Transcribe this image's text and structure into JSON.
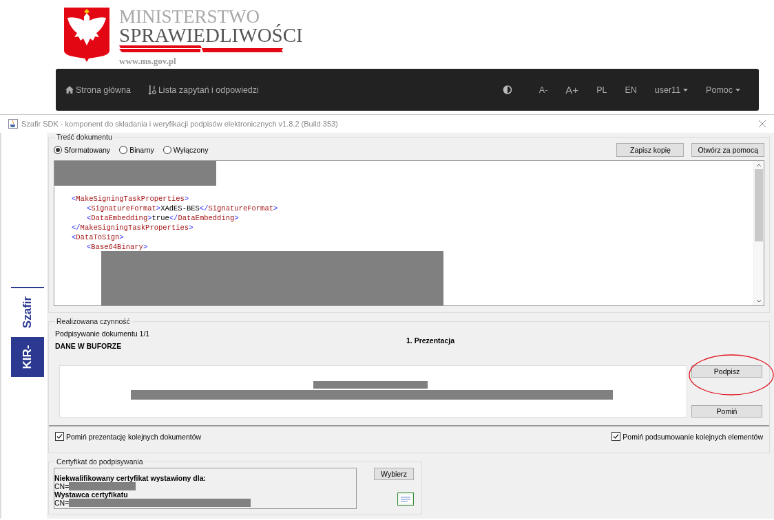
{
  "header": {
    "title_line1": "MINISTERSTWO",
    "title_line2": "SPRAWIEDLIWOŚCI",
    "url": "www.ms.gov.pl"
  },
  "nav": {
    "left": [
      {
        "kind": "home",
        "label": "Strona główna"
      },
      {
        "kind": "sort",
        "label": "Lista zapytań i odpowiedzi"
      }
    ],
    "right": [
      {
        "kind": "contrast"
      },
      {
        "kind": "text",
        "label": "A-"
      },
      {
        "kind": "large",
        "label": "A+"
      },
      {
        "kind": "text",
        "label": "PL"
      },
      {
        "kind": "text",
        "label": "EN"
      },
      {
        "kind": "dropdown",
        "label": "user11"
      },
      {
        "kind": "dropdown",
        "label": "Pomoc"
      }
    ]
  },
  "dialog": {
    "title": "Szafir SDK - komponent do składania i weryfikacji podpisów elektronicznych v1.8.2 (Build 353)",
    "sidebar": {
      "brand": "Szafir",
      "vendor": "KIR-"
    },
    "document": {
      "legend": "Treść dokumentu",
      "view_modes": [
        {
          "label": "Sformatowany",
          "selected": true
        },
        {
          "label": "Binarny",
          "selected": false
        },
        {
          "label": "Wyłączony",
          "selected": false
        }
      ],
      "buttons": [
        "Zapisz kopię",
        "Otwórz za pomocą"
      ],
      "xml_lines": [
        {
          "line": "<MakeSigningTaskProperties>",
          "children": [
            {
              "line": "<SignatureFormat>XAdES-BES</SignatureFormat>"
            },
            {
              "line": "<DataEmbedding>true</DataEmbedding>"
            }
          ]
        },
        {
          "line": "</MakeSigningTaskProperties>"
        },
        {
          "line": "<DataToSign>",
          "children": [
            {
              "line": "<Base64Binary>"
            }
          ]
        }
      ]
    },
    "task": {
      "legend": "Realizowana czynność",
      "progress": "Podpisywanie dokumentu 1/1",
      "source": "DANE W BUFORZE",
      "step": "1. Prezentacja",
      "buttons": [
        {
          "label": "Podpisz",
          "highlighted": true
        },
        {
          "label": "Pomiń",
          "highlighted": false
        }
      ],
      "options": [
        {
          "label": "Pomiń prezentację kolejnych dokumentów",
          "checked": true
        },
        {
          "label": "Pomiń podsumowanie kolejnych elementów",
          "checked": true
        }
      ]
    },
    "certificate": {
      "legend": "Certyfikat do podpisywania",
      "lines": [
        {
          "kind": "heading",
          "text": "Niekwalifikowany certyfikat wystawiony dla:"
        },
        {
          "kind": "field",
          "text": "CN="
        },
        {
          "kind": "heading",
          "text": "Wystawca certyfikatu"
        },
        {
          "kind": "field",
          "text": "CN="
        }
      ],
      "button": "Wybierz"
    }
  }
}
